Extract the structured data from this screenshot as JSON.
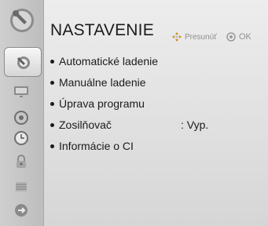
{
  "header": {
    "title": "NASTAVENIE",
    "hint_move": "Presunúť",
    "hint_ok": "OK"
  },
  "menu_items": [
    {
      "label": "Automatické ladenie"
    },
    {
      "label": "Manuálne ladenie"
    },
    {
      "label": "Úprava programu"
    },
    {
      "label": "Zosilňovač",
      "value": ": Vyp."
    },
    {
      "label": "Informácie o CI"
    }
  ],
  "sidebar": {
    "items": [
      {
        "icon": "setup-icon",
        "selected": true
      },
      {
        "icon": "picture-icon",
        "selected": false
      },
      {
        "icon": "audio-icon",
        "selected": false
      },
      {
        "icon": "time-icon",
        "selected": false
      },
      {
        "icon": "lock-icon",
        "selected": false
      },
      {
        "icon": "option-icon",
        "selected": false
      },
      {
        "icon": "input-icon",
        "selected": false
      }
    ]
  },
  "colors": {
    "background": "#e3e3e3",
    "sidebar": "#c8c8c8",
    "text": "#1b1b1b",
    "hint": "#8f8f8f"
  }
}
